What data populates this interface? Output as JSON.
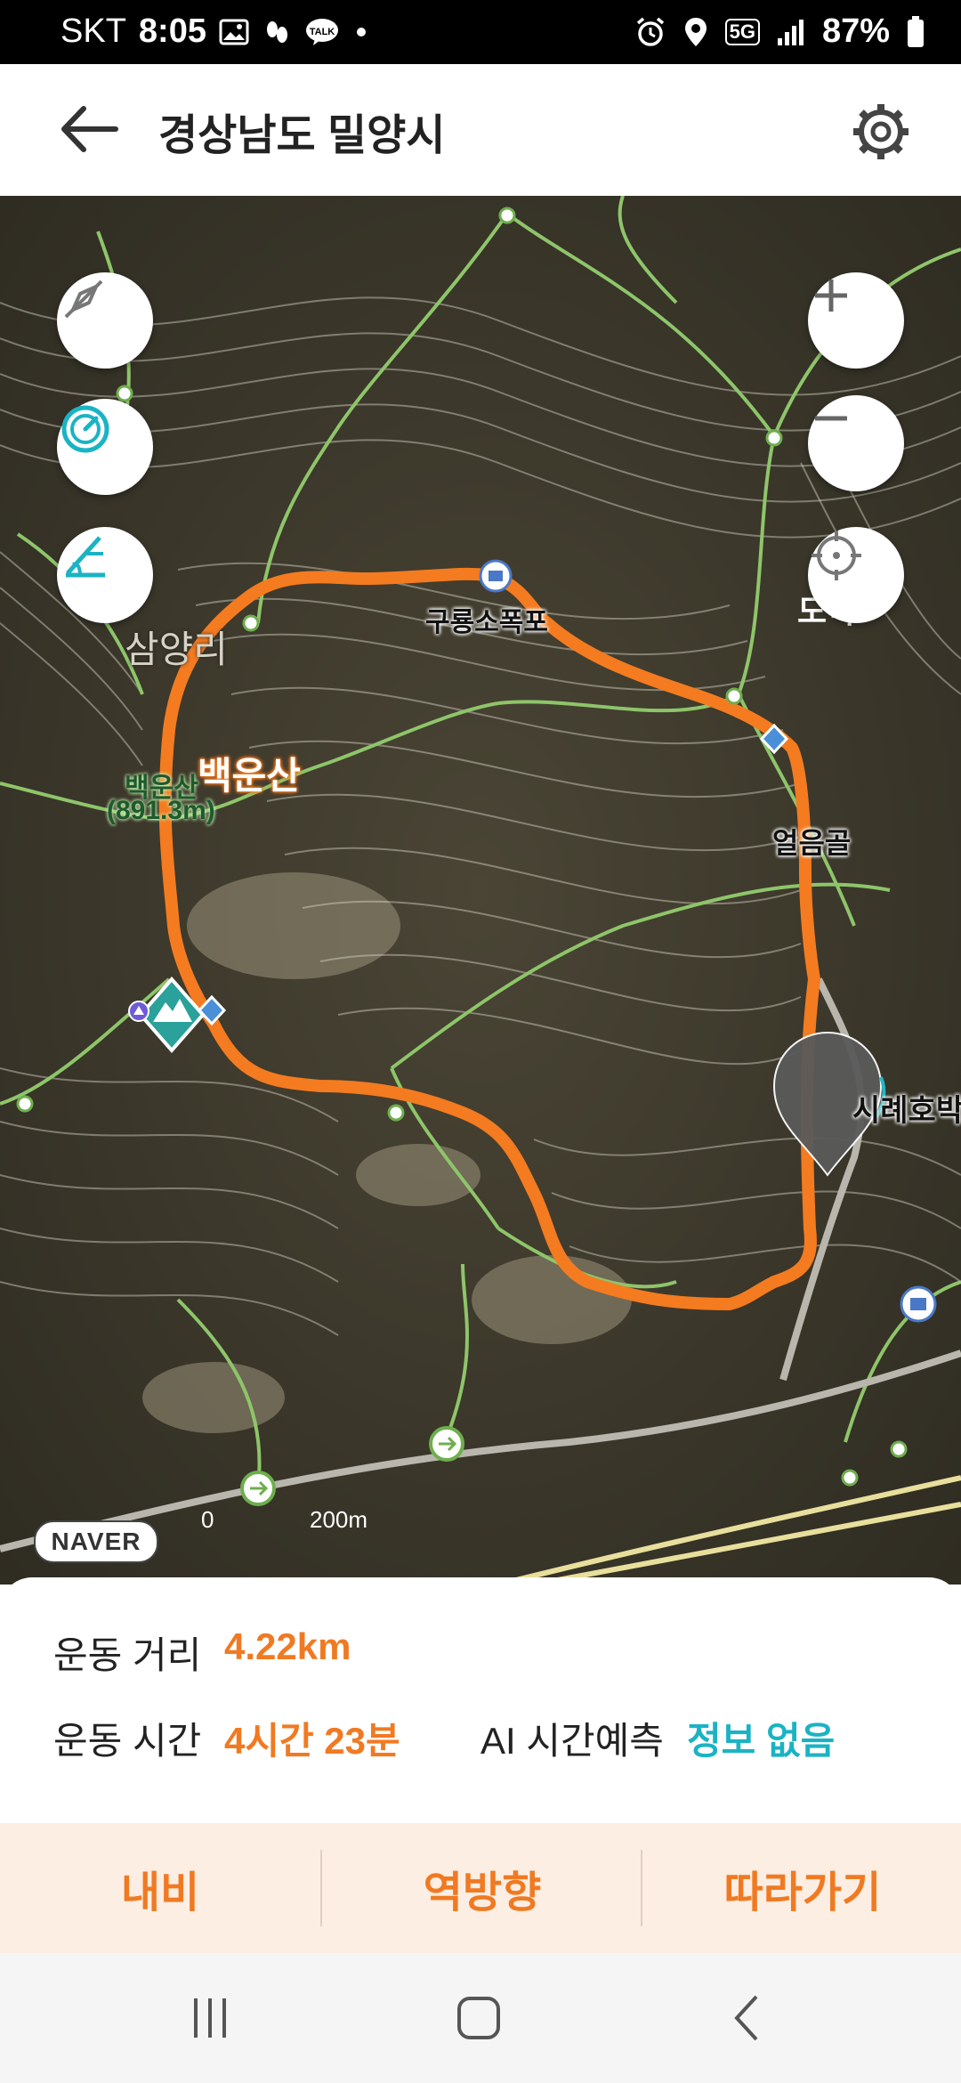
{
  "status_bar": {
    "carrier": "SKT",
    "time": "8:05",
    "network": "5G",
    "battery": "87%",
    "left_icons": [
      "gallery-icon",
      "footprint-icon",
      "kakaotalk-icon",
      "dot-icon"
    ],
    "right_icons": [
      "alarm-icon",
      "location-icon",
      "signal-icon",
      "battery-icon"
    ]
  },
  "header": {
    "title": "경상남도 밀양시"
  },
  "map": {
    "labels": {
      "shelter": "구룡소폭포",
      "village": "삼양리",
      "peak_name": "백운산",
      "peak_info_name": "백운산",
      "peak_info_height": "(891.3m)",
      "destination_place": "얼음골",
      "museum": "시례호박"
    },
    "arrival_marker": "도착",
    "brand": "NAVER",
    "scale": {
      "start": "0",
      "end": "200m"
    },
    "controls_left": [
      "compass-off-icon",
      "speedometer-icon",
      "slope-icon"
    ],
    "controls_right": [
      "zoom-in-icon",
      "zoom-out-icon",
      "locate-icon"
    ],
    "route_color": "#f47b20"
  },
  "stats": {
    "distance_label": "운동 거리",
    "distance_value": "4.22km",
    "time_label": "운동 시간",
    "time_value": "4시간 23분",
    "ai_label": "AI 시간예측",
    "ai_value": "정보 없음"
  },
  "actions": {
    "navigation": "내비",
    "reverse": "역방향",
    "follow": "따라가기"
  },
  "nav_bar": [
    "recent-apps-icon",
    "home-icon",
    "back-icon"
  ]
}
